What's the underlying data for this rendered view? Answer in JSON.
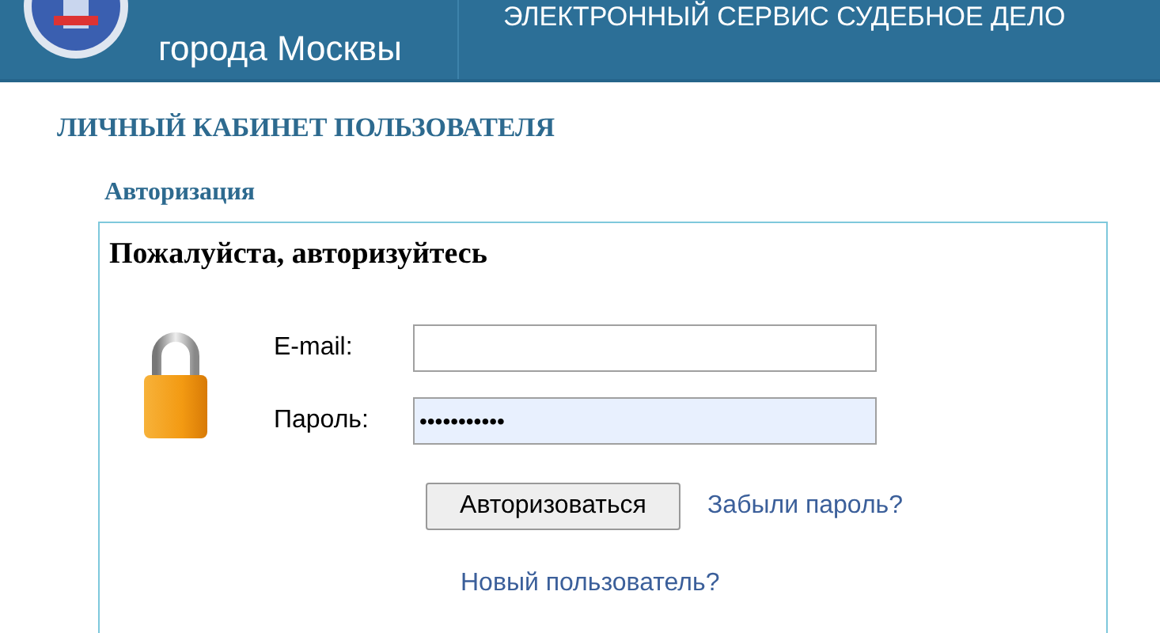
{
  "header": {
    "site_name": "города Москвы",
    "service_title": "ЭЛЕКТРОННЫЙ СЕРВИС СУДЕБНОЕ ДЕЛО"
  },
  "page_title": "ЛИЧНЫЙ КАБИНЕТ ПОЛЬЗОВАТЕЛЯ",
  "section_title": "Авторизация",
  "login_form": {
    "heading": "Пожалуйста, авторизуйтесь",
    "fields": [
      {
        "label": "E-mail:",
        "focused": false
      },
      {
        "label": "Пароль:",
        "value": "•••••••••••",
        "focused": true
      }
    ],
    "submit": "Авторизоваться",
    "forgot_link": "Забыли пароль?",
    "register_link": "Новый пользователь?"
  }
}
